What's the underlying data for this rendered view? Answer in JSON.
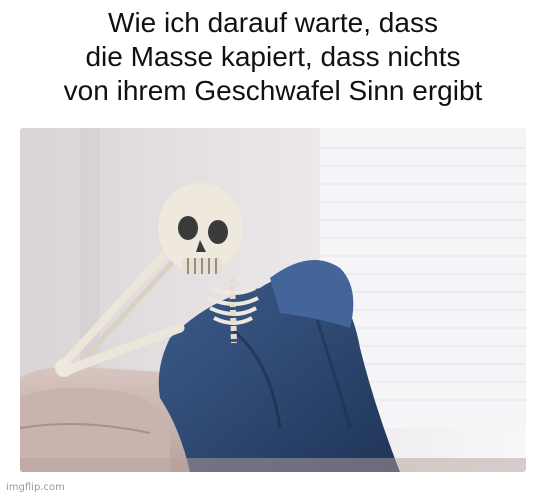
{
  "caption": {
    "lines": [
      "Wie ich darauf warte, dass",
      "die Masse kapiert, dass nichts",
      "von ihrem Geschwafel Sinn ergibt"
    ]
  },
  "photo": {
    "scene_colors": {
      "wall": "#e6e2e4",
      "window_light": "#f4f4f6",
      "couch": "#cdb8b4",
      "blanket": "#2e4a73",
      "bone": "#efe9dd"
    }
  },
  "footer": {
    "watermark": "imgflip.com"
  }
}
